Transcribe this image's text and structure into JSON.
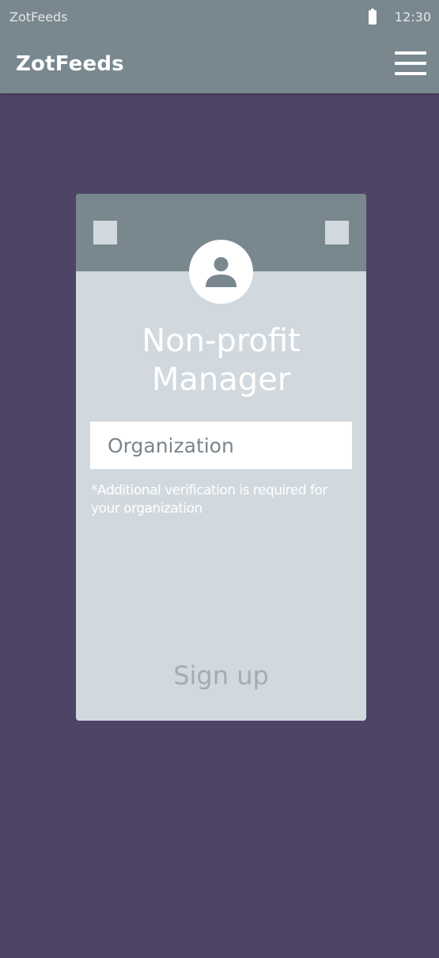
{
  "status_bar": {
    "app_name": "ZotFeeds",
    "time": "12:30",
    "battery_icon": "battery-icon"
  },
  "app_bar": {
    "title": "ZotFeeds",
    "menu_icon": "menu-icon"
  },
  "card": {
    "avatar_icon": "person-icon",
    "title": "Non-profit Manager",
    "organization_placeholder": "Organization",
    "organization_value": "",
    "note": "*Additional verification is required for your organization",
    "signup_label": "Sign up"
  },
  "colors": {
    "background": "#4d4466",
    "bar": "#78888e",
    "card": "#d1d9df",
    "text_light": "#ffffff",
    "signup_text": "#a5abaf"
  }
}
